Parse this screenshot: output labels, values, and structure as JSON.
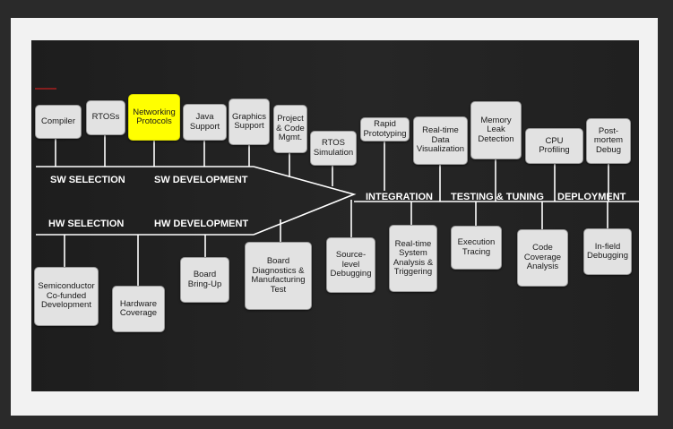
{
  "colors": {
    "background": "#2a2a2a",
    "frame": "#f2f2f2",
    "canvas": "#222222",
    "box_fill": "#e2e2e2",
    "highlight": "#ffff00",
    "line": "#ffffff",
    "phase_text": "#ffffff"
  },
  "phases": {
    "sw_selection": "SW SELECTION",
    "sw_development": "SW DEVELOPMENT",
    "hw_selection": "HW SELECTION",
    "hw_development": "HW DEVELOPMENT",
    "integration": "INTEGRATION",
    "testing_tuning": "TESTING & TUNING",
    "deployment": "DEPLOYMENT"
  },
  "top_boxes": [
    {
      "label": "Compiler"
    },
    {
      "label": "RTOSs"
    },
    {
      "label": "Networking\nProtocols",
      "highlighted": true
    },
    {
      "label": "Java\nSupport"
    },
    {
      "label": "Graphics\nSupport"
    },
    {
      "label": "Project\n& Code\nMgmt."
    },
    {
      "label": "RTOS\nSimulation"
    },
    {
      "label": "Rapid\nPrototyping"
    },
    {
      "label": "Real-time\nData\nVisualization"
    },
    {
      "label": "Memory\nLeak\nDetection"
    },
    {
      "label": "CPU\nProfiling"
    },
    {
      "label": "Post-\nmortem\nDebug"
    }
  ],
  "bottom_boxes": [
    {
      "label": "Semiconductor\nCo-funded\nDevelopment"
    },
    {
      "label": "Hardware\nCoverage"
    },
    {
      "label": "Board\nBring-Up"
    },
    {
      "label": "Board\nDiagnostics &\nManufacturing\nTest"
    },
    {
      "label": "Source-\nlevel\nDebugging"
    },
    {
      "label": "Real-time\nSystem\nAnalysis &\nTriggering"
    },
    {
      "label": "Execution\nTracing"
    },
    {
      "label": "Code\nCoverage\nAnalysis"
    },
    {
      "label": "In-field\nDebugging"
    }
  ]
}
